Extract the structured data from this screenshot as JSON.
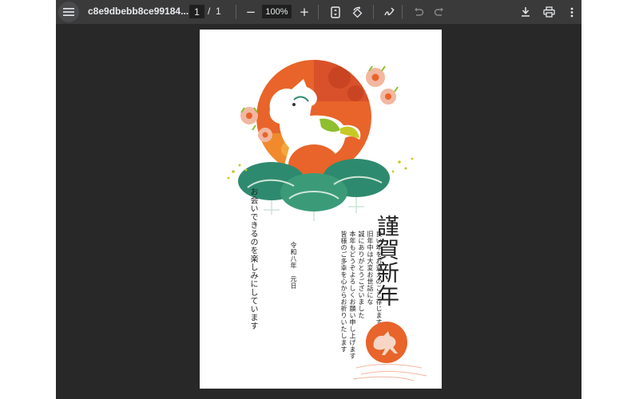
{
  "toolbar": {
    "file_name": "c8e9dbebb8ce99184...",
    "current_page": "1",
    "page_separator": "/",
    "total_pages": "1",
    "zoom_minus": "−",
    "zoom_level": "100%",
    "zoom_plus": "+"
  },
  "card": {
    "title_chars": [
      "謹",
      "賀",
      "新",
      "年"
    ],
    "body_lines": [
      "良い年をお迎えのこと存じます",
      "旧年中は大変お世話にな",
      "誠にありがとうございました",
      "本年もどうぞよろしくお願い申し上げます",
      "皆様のご多幸を心からお祈りいたします"
    ],
    "date_line": "令和八年　元日",
    "closing_line": "お会いできるのを楽しみにしています"
  },
  "colors": {
    "toolbar_bg": "#3a3a3b",
    "viewer_bg": "#282828",
    "annotation_arrow": "#ee0000",
    "sun_orange": "#e8642a",
    "pine_green": "#2e8a6e"
  },
  "icons": {
    "menu": "hamburger-icon",
    "fit": "fit-page-icon",
    "rotate": "rotate-icon",
    "annotate": "pen-icon",
    "undo": "undo-icon",
    "redo": "redo-icon",
    "download": "download-icon",
    "print": "printer-icon",
    "more": "more-vertical-icon"
  }
}
